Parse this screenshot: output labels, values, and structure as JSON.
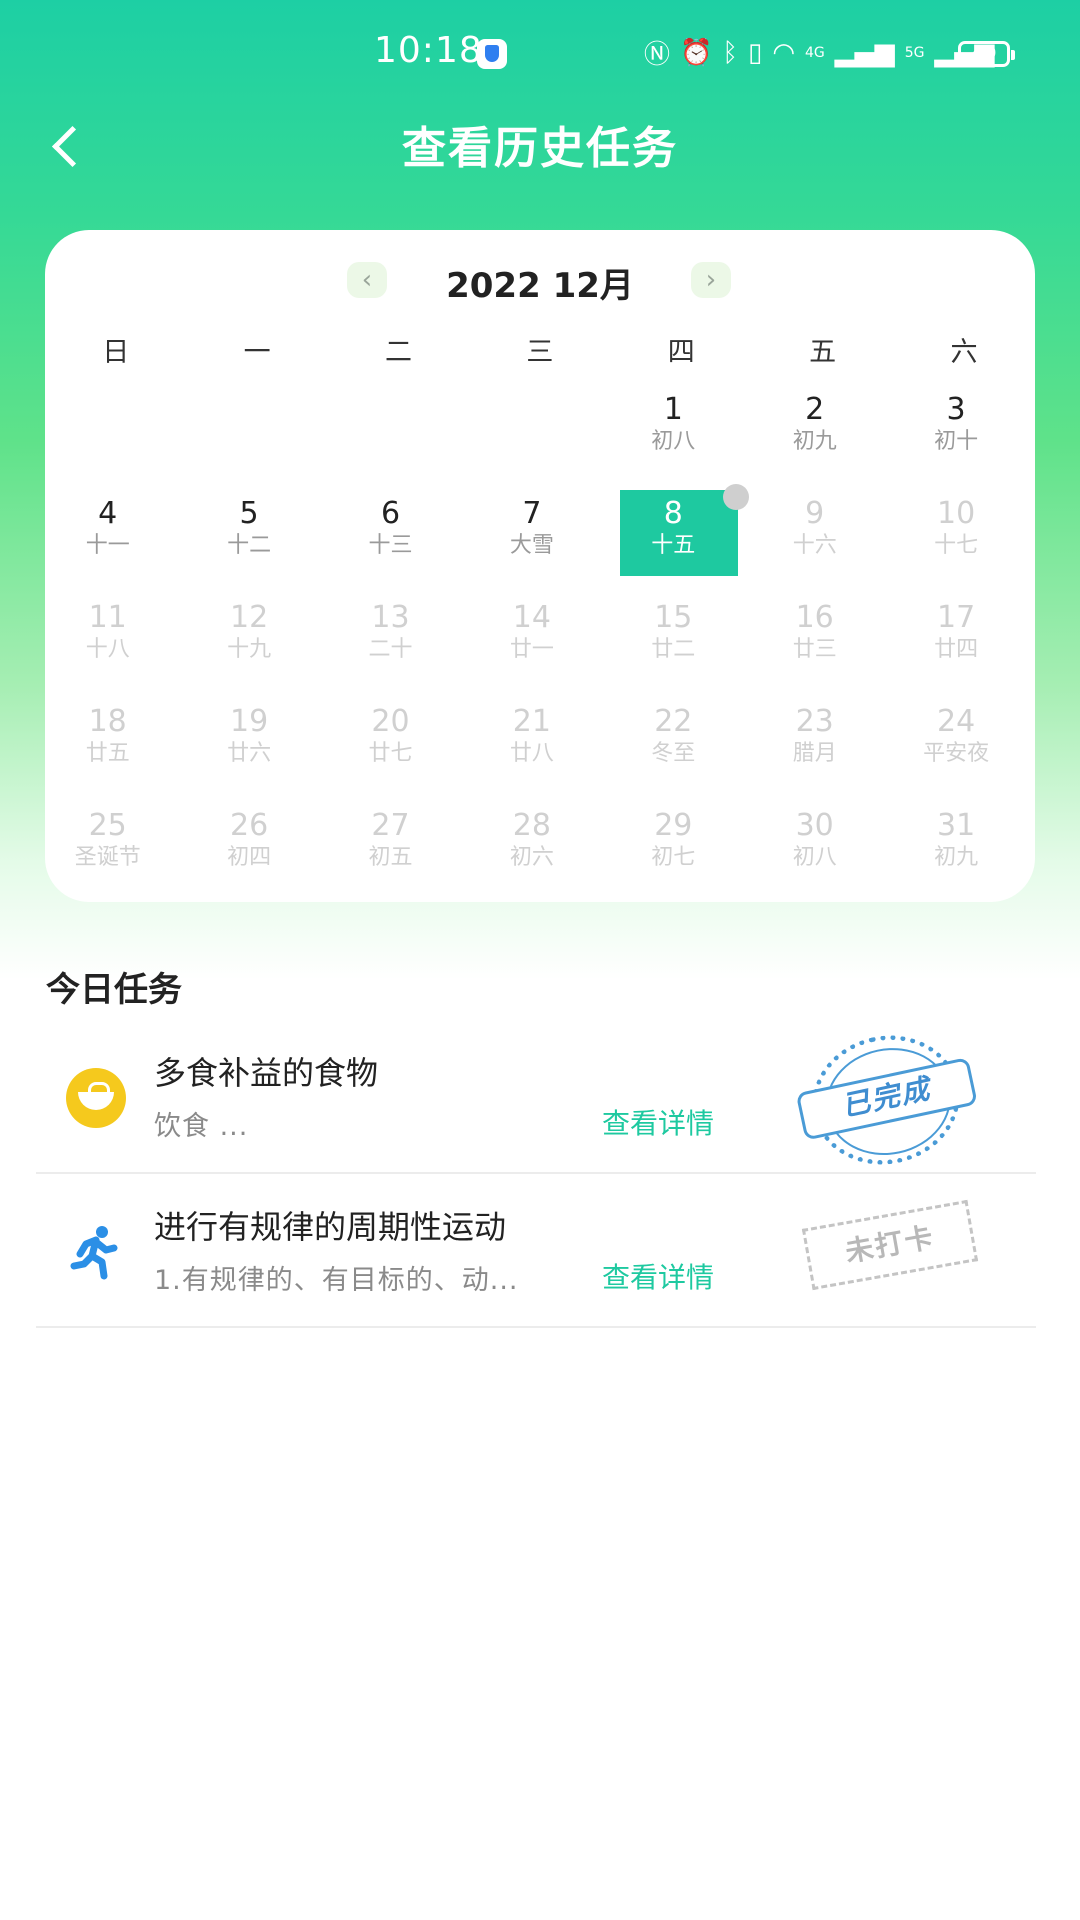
{
  "status_bar": {
    "time": "10:18",
    "signal_4g": "4G",
    "signal_5g": "5G",
    "battery": "49"
  },
  "nav": {
    "title": "查看历史任务"
  },
  "calendar": {
    "month_title": "2022 12月",
    "weekdays": [
      "日",
      "一",
      "二",
      "三",
      "四",
      "五",
      "六"
    ],
    "days": [
      {
        "day": "1",
        "lunar": "初八",
        "state": "active"
      },
      {
        "day": "2",
        "lunar": "初九",
        "state": "active"
      },
      {
        "day": "3",
        "lunar": "初十",
        "state": "active"
      },
      {
        "day": "4",
        "lunar": "十一",
        "state": "active"
      },
      {
        "day": "5",
        "lunar": "十二",
        "state": "active"
      },
      {
        "day": "6",
        "lunar": "十三",
        "state": "active"
      },
      {
        "day": "7",
        "lunar": "大雪",
        "state": "active"
      },
      {
        "day": "8",
        "lunar": "十五",
        "state": "selected",
        "has_task": true
      },
      {
        "day": "9",
        "lunar": "十六",
        "state": "future"
      },
      {
        "day": "10",
        "lunar": "十七",
        "state": "future"
      },
      {
        "day": "11",
        "lunar": "十八",
        "state": "future"
      },
      {
        "day": "12",
        "lunar": "十九",
        "state": "future"
      },
      {
        "day": "13",
        "lunar": "二十",
        "state": "future"
      },
      {
        "day": "14",
        "lunar": "廿一",
        "state": "future"
      },
      {
        "day": "15",
        "lunar": "廿二",
        "state": "future"
      },
      {
        "day": "16",
        "lunar": "廿三",
        "state": "future"
      },
      {
        "day": "17",
        "lunar": "廿四",
        "state": "future"
      },
      {
        "day": "18",
        "lunar": "廿五",
        "state": "future"
      },
      {
        "day": "19",
        "lunar": "廿六",
        "state": "future"
      },
      {
        "day": "20",
        "lunar": "廿七",
        "state": "future"
      },
      {
        "day": "21",
        "lunar": "廿八",
        "state": "future"
      },
      {
        "day": "22",
        "lunar": "冬至",
        "state": "future"
      },
      {
        "day": "23",
        "lunar": "腊月",
        "state": "future"
      },
      {
        "day": "24",
        "lunar": "平安夜",
        "state": "future"
      },
      {
        "day": "25",
        "lunar": "圣诞节",
        "state": "future"
      },
      {
        "day": "26",
        "lunar": "初四",
        "state": "future"
      },
      {
        "day": "27",
        "lunar": "初五",
        "state": "future"
      },
      {
        "day": "28",
        "lunar": "初六",
        "state": "future"
      },
      {
        "day": "29",
        "lunar": "初七",
        "state": "future"
      },
      {
        "day": "30",
        "lunar": "初八",
        "state": "future"
      },
      {
        "day": "31",
        "lunar": "初九",
        "state": "future"
      }
    ]
  },
  "tasks": {
    "section_title": "今日任务",
    "items": [
      {
        "name": "多食补益的食物",
        "desc": "饮食 ...",
        "link": "查看详情",
        "stamp": "已完成",
        "icon": "food-bowl-icon"
      },
      {
        "name": "进行有规律的周期性运动",
        "desc": "1.有规律的、有目标的、动...",
        "link": "查看详情",
        "stamp": "未打卡",
        "icon": "runner-icon"
      }
    ]
  },
  "colors": {
    "accent": "#1ec9a0",
    "header_top": "#1dcfa4",
    "stamp_done": "#4a9bd6",
    "stamp_pending": "#b8b8b8"
  }
}
